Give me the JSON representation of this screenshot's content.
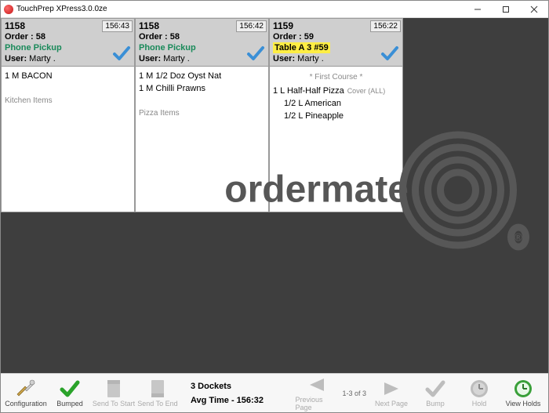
{
  "window": {
    "title": "TouchPrep XPress3.0.0ze"
  },
  "tickets": [
    {
      "number": "1158",
      "order": "Order : 58",
      "location": "Phone Pickup",
      "location_type": "pickup",
      "user_label": "User:",
      "user_name": "Marty .",
      "timer": "156:43",
      "course": "",
      "items": [
        {
          "text": "1 M BACON",
          "cover": "",
          "subs": []
        }
      ],
      "footer": "Kitchen Items"
    },
    {
      "number": "1158",
      "order": "Order : 58",
      "location": "Phone Pickup",
      "location_type": "pickup",
      "user_label": "User:",
      "user_name": "Marty .",
      "timer": "156:42",
      "course": "",
      "items": [
        {
          "text": "1 M 1/2 Doz Oyst Nat",
          "cover": "",
          "subs": []
        },
        {
          "text": "1 M Chilli Prawns",
          "cover": "",
          "subs": []
        }
      ],
      "footer": "Pizza Items"
    },
    {
      "number": "1159",
      "order": "Order : 59",
      "location": "Table A 3 #59",
      "location_type": "table",
      "user_label": "User:",
      "user_name": "Marty .",
      "timer": "156:22",
      "course": "* First Course *",
      "items": [
        {
          "text": "1 L Half-Half Pizza",
          "cover": "Cover (ALL)",
          "subs": [
            "1/2 L American",
            "1/2 L Pineapple"
          ]
        }
      ],
      "footer": ""
    }
  ],
  "toolbar": {
    "configuration": "Configuration",
    "bumped": "Bumped",
    "send_to_start": "Send To Start",
    "send_to_end": "Send To End",
    "previous_page": "Previous Page",
    "next_page": "Next Page",
    "bump": "Bump",
    "hold": "Hold",
    "view_holds": "View Holds",
    "page_indicator": "1-3 of 3"
  },
  "status": {
    "dockets": "3 Dockets",
    "avg_time": "Avg Time - 156:32"
  },
  "watermark": {
    "text": "ordermate",
    "reg": "®"
  }
}
